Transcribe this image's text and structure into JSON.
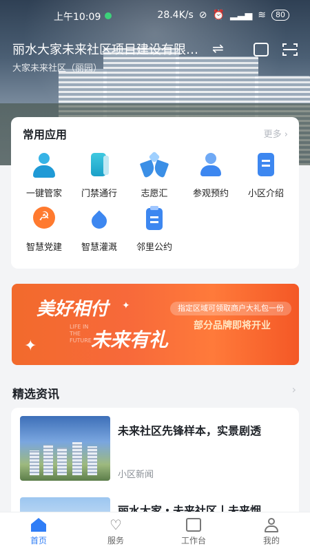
{
  "status_bar": {
    "time": "上午10:09",
    "speed": "28.4K/s",
    "battery": "80"
  },
  "header": {
    "title": "丽水大家未来社区项目建设有限…",
    "subtitle": "大家未来社区（丽园）"
  },
  "apps": {
    "heading": "常用应用",
    "more": "更多",
    "items": [
      {
        "label": "一键管家",
        "icon": "butler-icon"
      },
      {
        "label": "门禁通行",
        "icon": "door-icon"
      },
      {
        "label": "志愿汇",
        "icon": "volunteer-icon"
      },
      {
        "label": "参观预约",
        "icon": "visit-icon"
      },
      {
        "label": "小区介绍",
        "icon": "intro-icon"
      },
      {
        "label": "智慧党建",
        "icon": "party-icon"
      },
      {
        "label": "智慧灌溉",
        "icon": "irrigation-icon"
      },
      {
        "label": "邻里公约",
        "icon": "convention-icon"
      }
    ]
  },
  "banner": {
    "line1": "美好相付",
    "line2": "未来有礼",
    "english": "LIFE IN THE FUTURE",
    "pill": "指定区域可领取商户大礼包一份",
    "sub": "部分品牌即将开业"
  },
  "news": {
    "heading": "精选资讯",
    "items": [
      {
        "title": "未来社区先锋样本，实景剧透",
        "tag": "小区新闻"
      },
      {
        "title": "丽水大家・未来社区丨未来烟",
        "tag": ""
      }
    ]
  },
  "tabs": [
    {
      "label": "首页",
      "icon": "home-icon"
    },
    {
      "label": "服务",
      "icon": "heart-icon"
    },
    {
      "label": "工作台",
      "icon": "workbench-icon"
    },
    {
      "label": "我的",
      "icon": "profile-icon"
    }
  ],
  "colors": {
    "accent": "#2f7df6",
    "banner": "#f26a2c"
  }
}
